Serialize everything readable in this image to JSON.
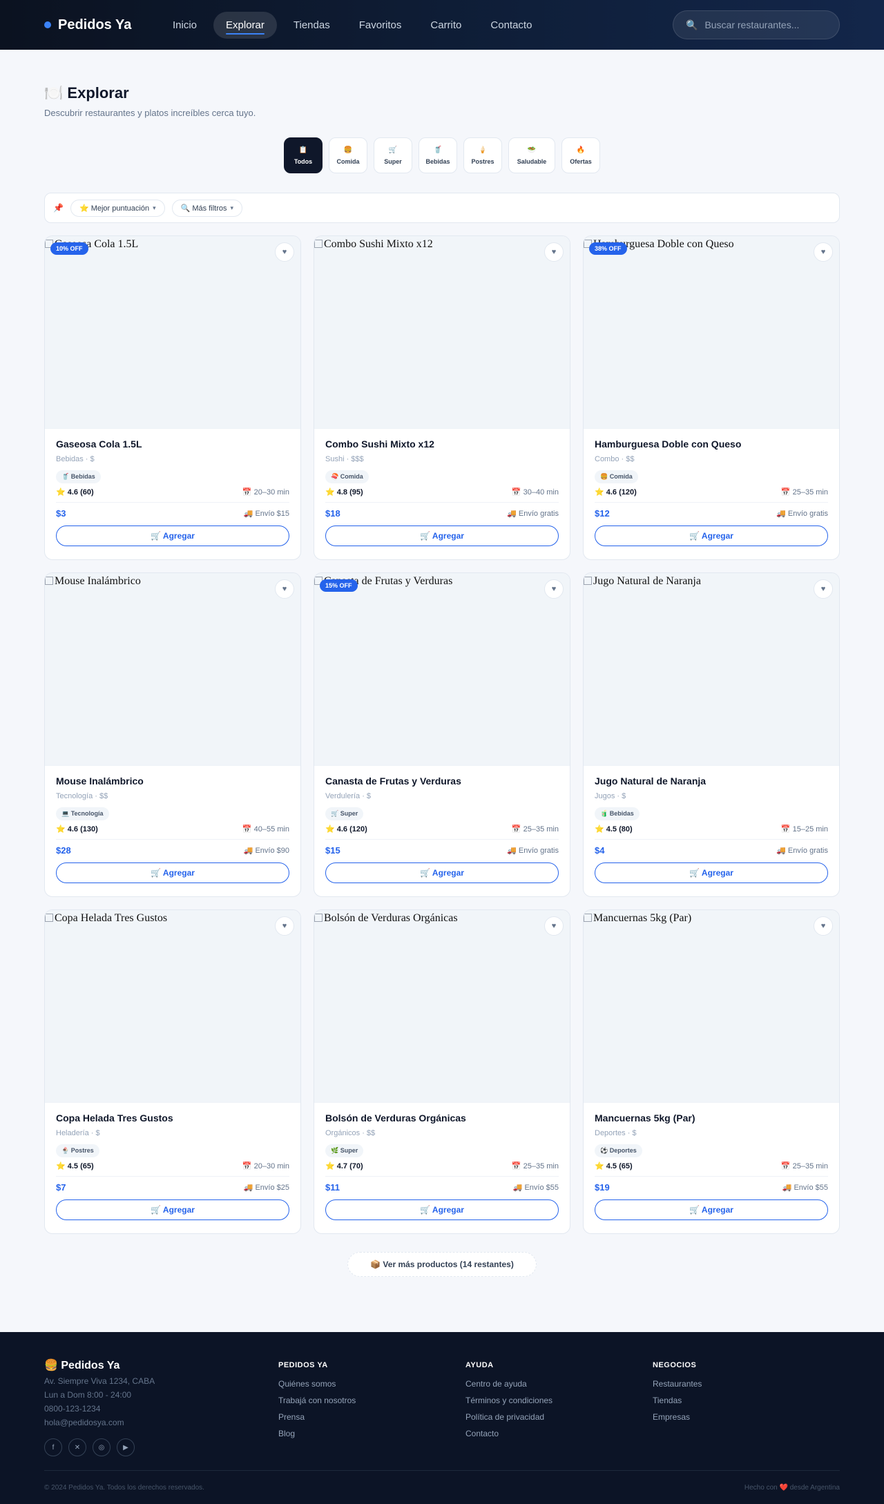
{
  "nav": {
    "brand": "Pedidos Ya",
    "links": [
      {
        "label": "Inicio",
        "active": false
      },
      {
        "label": "Explorar",
        "active": true
      },
      {
        "label": "Tiendas",
        "active": false
      },
      {
        "label": "Favoritos",
        "active": false
      },
      {
        "label": "Carrito",
        "active": false
      },
      {
        "label": "Contacto",
        "active": false
      }
    ],
    "search_placeholder": "Buscar restaurantes...",
    "search_icon": "🔍"
  },
  "header": {
    "icon": "🍽️",
    "title": "Explorar",
    "subtitle": "Descubrir restaurantes y platos increíbles cerca tuyo."
  },
  "categories": [
    {
      "icon": "📋",
      "label": "Todos",
      "active": true
    },
    {
      "icon": "🍔",
      "label": "Comida",
      "active": false
    },
    {
      "icon": "🛒",
      "label": "Super",
      "active": false
    },
    {
      "icon": "🥤",
      "label": "Bebidas",
      "active": false
    },
    {
      "icon": "🍦",
      "label": "Postres",
      "active": false
    },
    {
      "icon": "🥗",
      "label": "Saludable",
      "active": false
    },
    {
      "icon": "🔥",
      "label": "Ofertas",
      "active": false
    }
  ],
  "filters": {
    "pin_icon": "📌",
    "sort_label": "⭐ Mejor puntuación",
    "more_label": "🔍 Más filtros",
    "caret": "▾"
  },
  "products": [
    {
      "name": "Gaseosa Cola 1.5L",
      "meta": "Bebidas · $",
      "tag": "🥤 Bebidas",
      "rating": "⭐ 4.6 (60)",
      "time": "📅 20–30 min",
      "price": "$3",
      "ship": "🚚 Envío $15",
      "discount": "10% OFF"
    },
    {
      "name": "Combo Sushi Mixto x12",
      "meta": "Sushi · $$$",
      "tag": "🍣 Comida",
      "rating": "⭐ 4.8 (95)",
      "time": "📅 30–40 min",
      "price": "$18",
      "ship": "🚚 Envío gratis",
      "discount": ""
    },
    {
      "name": "Hamburguesa Doble con Queso",
      "meta": "Combo · $$",
      "tag": "🍔 Comida",
      "rating": "⭐ 4.6 (120)",
      "time": "📅 25–35 min",
      "price": "$12",
      "ship": "🚚 Envío gratis",
      "discount": "38% OFF"
    },
    {
      "name": "Mouse Inalámbrico",
      "meta": "Tecnología · $$",
      "tag": "💻 Tecnología",
      "rating": "⭐ 4.6 (130)",
      "time": "📅 40–55 min",
      "price": "$28",
      "ship": "🚚 Envío $90",
      "discount": ""
    },
    {
      "name": "Canasta de Frutas y Verduras",
      "meta": "Verdulería · $",
      "tag": "🛒 Super",
      "rating": "⭐ 4.6 (120)",
      "time": "📅 25–35 min",
      "price": "$15",
      "ship": "🚚 Envío gratis",
      "discount": "15% OFF"
    },
    {
      "name": "Jugo Natural de Naranja",
      "meta": "Jugos · $",
      "tag": "🧃 Bebidas",
      "rating": "⭐ 4.5 (80)",
      "time": "📅 15–25 min",
      "price": "$4",
      "ship": "🚚 Envío gratis",
      "discount": ""
    },
    {
      "name": "Copa Helada Tres Gustos",
      "meta": "Heladería · $",
      "tag": "🍨 Postres",
      "rating": "⭐ 4.5 (65)",
      "time": "📅 20–30 min",
      "price": "$7",
      "ship": "🚚 Envío $25",
      "discount": ""
    },
    {
      "name": "Bolsón de Verduras Orgánicas",
      "meta": "Orgánicos · $$",
      "tag": "🌿 Super",
      "rating": "⭐ 4.7 (70)",
      "time": "📅 25–35 min",
      "price": "$11",
      "ship": "🚚 Envío $55",
      "discount": ""
    },
    {
      "name": "Mancuernas 5kg (Par)",
      "meta": "Deportes · $",
      "tag": "⚽ Deportes",
      "rating": "⭐ 4.5 (65)",
      "time": "📅 25–35 min",
      "price": "$19",
      "ship": "🚚 Envío $55",
      "discount": ""
    }
  ],
  "card_ui": {
    "add_label": "🛒 Agregar",
    "fav_icon": "♥"
  },
  "more_button": "📦 Ver más productos (14 restantes)",
  "footer": {
    "brand": "🍔 Pedidos Ya",
    "address": "Av. Siempre Viva 1234, CABA",
    "hours": "Lun a Dom 8:00 - 24:00",
    "phone": "0800-123-1234",
    "email": "hola@pedidosya.com",
    "socials": [
      "f",
      "✕",
      "◎",
      "▶"
    ],
    "columns": [
      {
        "title": "PEDIDOS YA",
        "links": [
          "Quiénes somos",
          "Trabajá con nosotros",
          "Prensa",
          "Blog"
        ]
      },
      {
        "title": "AYUDA",
        "links": [
          "Centro de ayuda",
          "Términos y condiciones",
          "Política de privacidad",
          "Contacto"
        ]
      },
      {
        "title": "NEGOCIOS",
        "links": [
          "Restaurantes",
          "Tiendas",
          "Empresas"
        ]
      }
    ],
    "copyright": "© 2024 Pedidos Ya. Todos los derechos reservados.",
    "made_with": "Hecho con ❤️ desde Argentina"
  }
}
